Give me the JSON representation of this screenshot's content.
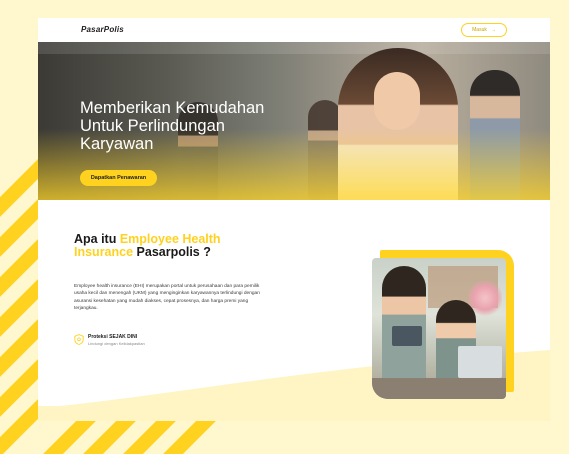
{
  "header": {
    "logo_text": "PasarPolis",
    "login_label": "Masuk",
    "login_arrow": "→"
  },
  "hero": {
    "title_line1": "Memberikan Kemudahan",
    "title_line2": "Untuk Perlindungan",
    "title_line3": "Karyawan",
    "cta_label": "Dapatkan Penawaran"
  },
  "about": {
    "heading_part1": "Apa itu ",
    "heading_highlight": "Employee Health Insurance",
    "heading_part2": " Pasarpolis ?",
    "description": "Employee health insurance (EHI) merupakan portal untuk perusahaan dan para pemilik usaha kecil dan menengah (UKM) yang menginginkan karyawannya terlindungi dengan asuransi kesehatan yang mudah diakses, cepat prosesnya, dan harga premi yang terjangkau.",
    "feature_title": "Proteksi SEJAK DINI",
    "feature_subtitle": "Lindungi dengan Kelidakpastian",
    "feature_icon": "shield-icon"
  },
  "colors": {
    "accent": "#ffd21f",
    "background": "#fff8cf",
    "text": "#1a1a1a"
  }
}
